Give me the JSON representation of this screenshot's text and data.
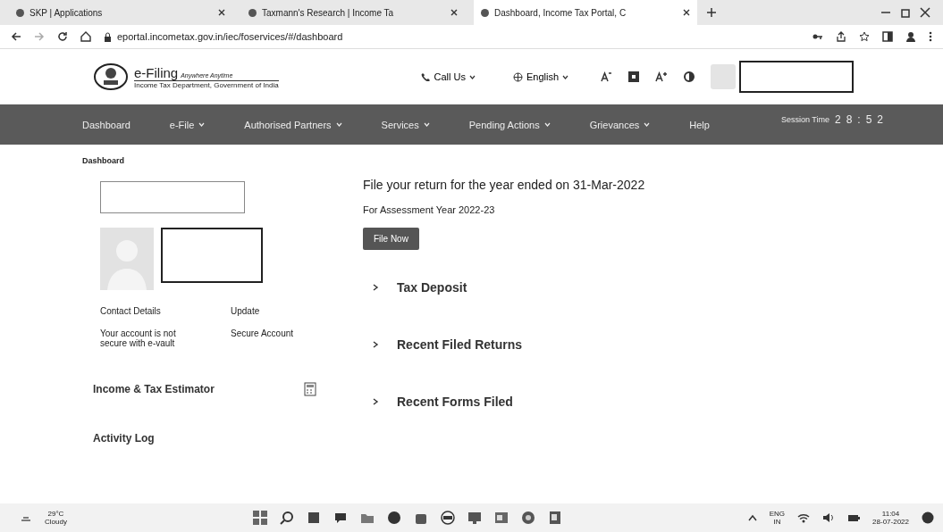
{
  "browser_tabs": [
    {
      "title": "SKP | Applications",
      "selected": false
    },
    {
      "title": "Taxmann's Research | Income Ta",
      "selected": false
    },
    {
      "title": "Dashboard, Income Tax Portal, C",
      "selected": true
    }
  ],
  "address_bar": {
    "url": "eportal.incometax.gov.in/iec/foservices/#/dashboard"
  },
  "header": {
    "logo_title": "e-Filing",
    "logo_tagline": "Anywhere Anytime",
    "logo_subtitle": "Income Tax Department, Government of India",
    "call_us": "Call Us",
    "language": "English"
  },
  "nav": {
    "items": [
      {
        "label": "Dashboard",
        "dropdown": false
      },
      {
        "label": "e-File",
        "dropdown": true
      },
      {
        "label": "Authorised Partners",
        "dropdown": true
      },
      {
        "label": "Services",
        "dropdown": true
      },
      {
        "label": "Pending Actions",
        "dropdown": true
      },
      {
        "label": "Grievances",
        "dropdown": true
      },
      {
        "label": "Help",
        "dropdown": false
      }
    ],
    "session_label": "Session Time",
    "session_digits": [
      "2",
      "8",
      ":",
      "5",
      "2"
    ]
  },
  "breadcrumb": "Dashboard",
  "profile": {
    "contact_label": "Contact Details",
    "contact_action": "Update",
    "security_note": "Your account is not secure with e-vault",
    "security_action": "Secure Account"
  },
  "side_links": [
    {
      "label": "Income & Tax Estimator",
      "kind": "calculator"
    },
    {
      "label": "Activity Log",
      "kind": "plain"
    }
  ],
  "return_card": {
    "title": "File your return for the year ended on 31-Mar-2022",
    "subtitle": "For Assessment Year 2022-23",
    "button": "File Now"
  },
  "sections": [
    {
      "title": "Tax Deposit",
      "expanded": false
    },
    {
      "title": "Recent Filed Returns",
      "expanded": false
    },
    {
      "title": "Recent Forms Filed",
      "expanded": false
    }
  ],
  "taskbar": {
    "temperature": "29°C",
    "weather": "Cloudy",
    "lang_top": "ENG",
    "lang_bottom": "IN",
    "time": "11:04",
    "date": "28-07-2022"
  }
}
